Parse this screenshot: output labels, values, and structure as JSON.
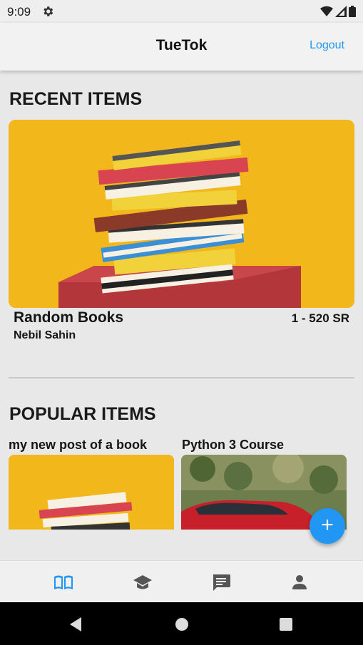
{
  "status_bar": {
    "time": "9:09",
    "icons": [
      "gear-icon",
      "wifi-icon",
      "signal-icon",
      "battery-icon"
    ]
  },
  "app_bar": {
    "title": "TueTok",
    "logout_label": "Logout"
  },
  "recent": {
    "heading": "RECENT ITEMS",
    "item": {
      "name": "Random Books",
      "author": "Nebil Sahin",
      "price": "1 - 520 SR"
    }
  },
  "popular": {
    "heading": "POPULAR ITEMS",
    "items": [
      {
        "title": "my new post of a book",
        "image": "books-image"
      },
      {
        "title": "Python 3 Course",
        "image": "car-image"
      }
    ]
  },
  "fab_label": "+",
  "bottom_nav": {
    "items": [
      {
        "icon": "book-icon",
        "active": true
      },
      {
        "icon": "school-icon",
        "active": false
      },
      {
        "icon": "chat-icon",
        "active": false
      },
      {
        "icon": "person-icon",
        "active": false
      }
    ]
  },
  "colors": {
    "accent": "#2196f3",
    "background": "#e8e8e8",
    "card_yellow": "#f2b71b"
  }
}
